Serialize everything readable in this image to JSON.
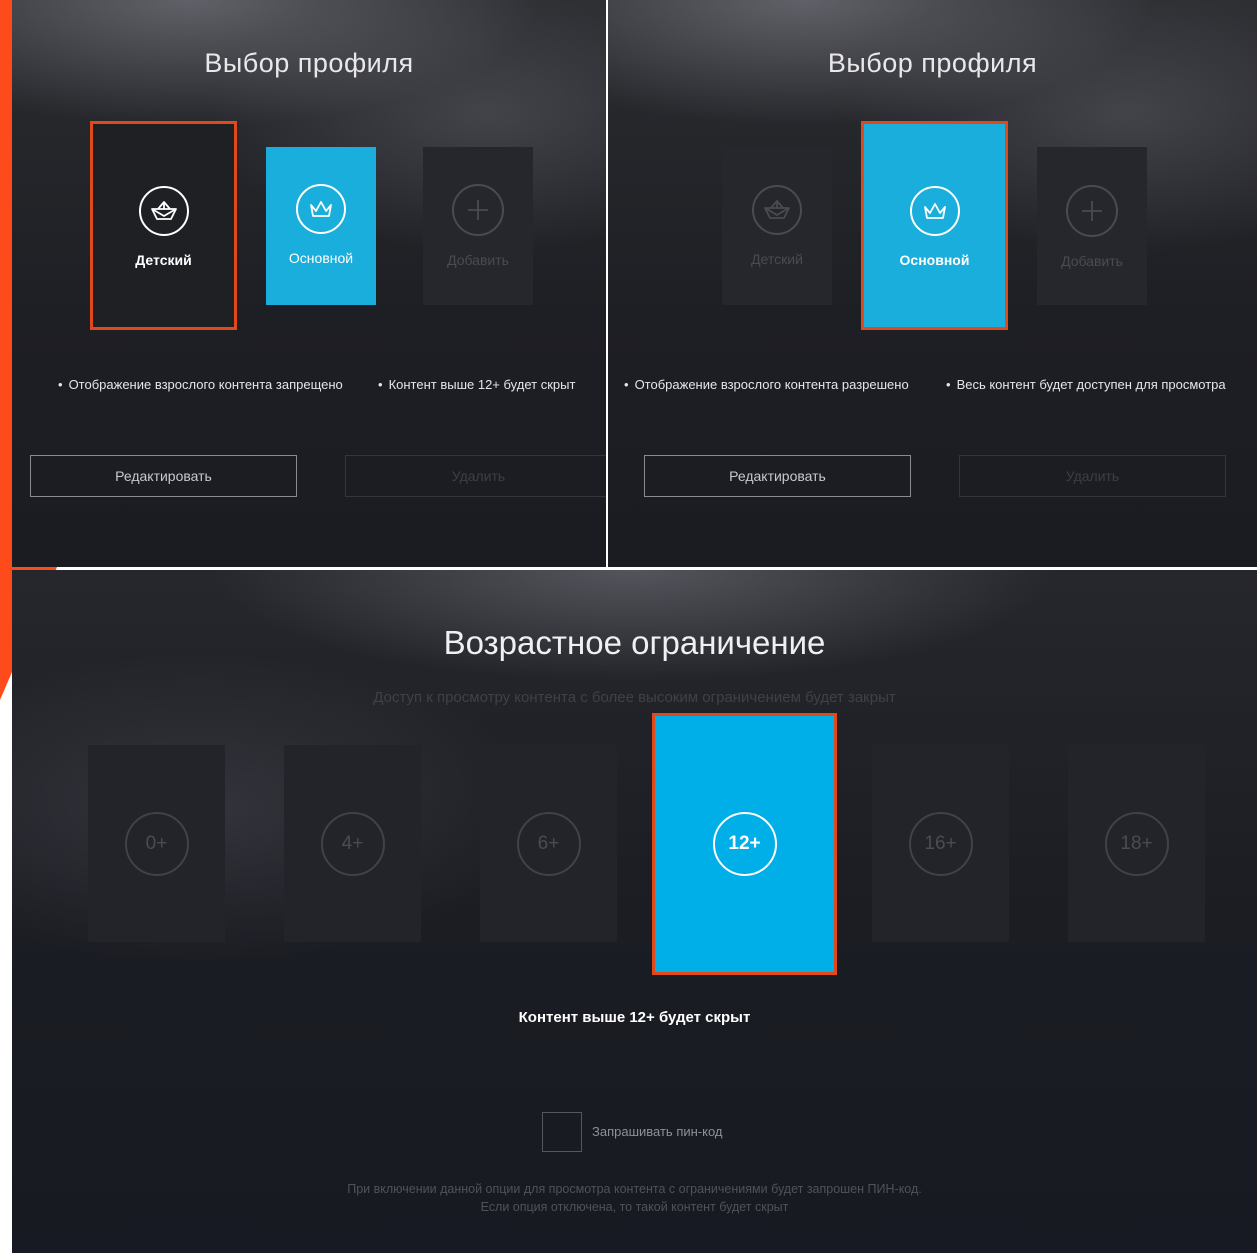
{
  "screen_a": {
    "title": "Выбор профиля",
    "profiles": [
      {
        "label": "Детский",
        "icon": "boat-icon",
        "state": "focused"
      },
      {
        "label": "Основной",
        "icon": "crown-icon",
        "state": "active"
      },
      {
        "label": "Добавить",
        "icon": "plus-icon",
        "state": "dim"
      }
    ],
    "bullets": [
      "Отображение взрослого контента запрещено",
      "Контент выше 12+ будет скрыт"
    ],
    "edit_label": "Редактировать",
    "delete_label": "Удалить"
  },
  "screen_b": {
    "title": "Выбор профиля",
    "profiles": [
      {
        "label": "Детский",
        "icon": "boat-icon",
        "state": "dim"
      },
      {
        "label": "Основной",
        "icon": "crown-icon",
        "state": "focused-active"
      },
      {
        "label": "Добавить",
        "icon": "plus-icon",
        "state": "dim"
      }
    ],
    "bullets": [
      "Отображение взрослого контента разрешено",
      "Весь контент будет доступен для просмотра"
    ],
    "edit_label": "Редактировать",
    "delete_label": "Удалить"
  },
  "screen_c": {
    "title": "Возрастное ограничение",
    "subtitle": "Доступ к просмотру контента с более высоким ограничением будет закрыт",
    "ratings": [
      "0+",
      "4+",
      "6+",
      "12+",
      "16+",
      "18+"
    ],
    "selected_rating": "12+",
    "note": "Контент выше 12+ будет скрыт",
    "pin_label": "Запрашивать пин-код",
    "pin_checked": false,
    "hint_line1": "При включении данной опции для просмотра контента с ограничениями будет запрошен ПИН-код.",
    "hint_line2": "Если опция отключена, то такой контент будет скрыт"
  },
  "colors": {
    "accent_blue": "#00aee8",
    "focus_orange": "#e04a1a",
    "brand_orange": "#ff4a1c",
    "background_dark": "#1e1f24"
  }
}
